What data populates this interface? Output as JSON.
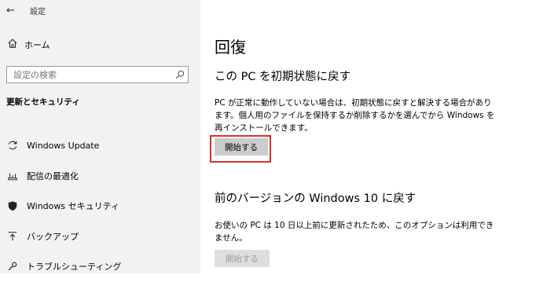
{
  "window": {
    "back_glyph": "←",
    "app_title": "設定"
  },
  "sidebar": {
    "home_label": "ホーム",
    "search": {
      "placeholder": "設定の検索"
    },
    "section_heading": "更新とセキュリティ",
    "items": [
      {
        "label": "Windows Update",
        "icon": "sync-icon"
      },
      {
        "label": "配信の最適化",
        "icon": "delivery-optimization-icon"
      },
      {
        "label": "Windows セキュリティ",
        "icon": "shield-icon"
      },
      {
        "label": "バックアップ",
        "icon": "backup-arrow-icon"
      },
      {
        "label": "トラブルシューティング",
        "icon": "wrench-icon"
      }
    ]
  },
  "main": {
    "page_title": "回復",
    "reset_section": {
      "heading": "この PC を初期状態に戻す",
      "description": "PC が正常に動作していない場合は、初期状態に戻すと解決する場合があります。個人用のファイルを保持するか削除するかを選んでから Windows を再インストールできます。",
      "button_label": "開始する"
    },
    "goback_section": {
      "heading": "前のバージョンの Windows 10 に戻す",
      "description": "お使いの PC は 10 日以上前に更新されたため、このオプションは利用できません。",
      "button_label": "開始する"
    }
  },
  "colors": {
    "sidebar_bg": "#f2f2f2",
    "highlight_border": "#d9302c",
    "button_bg": "#cccccc",
    "disabled_text": "#9c9c9c"
  }
}
